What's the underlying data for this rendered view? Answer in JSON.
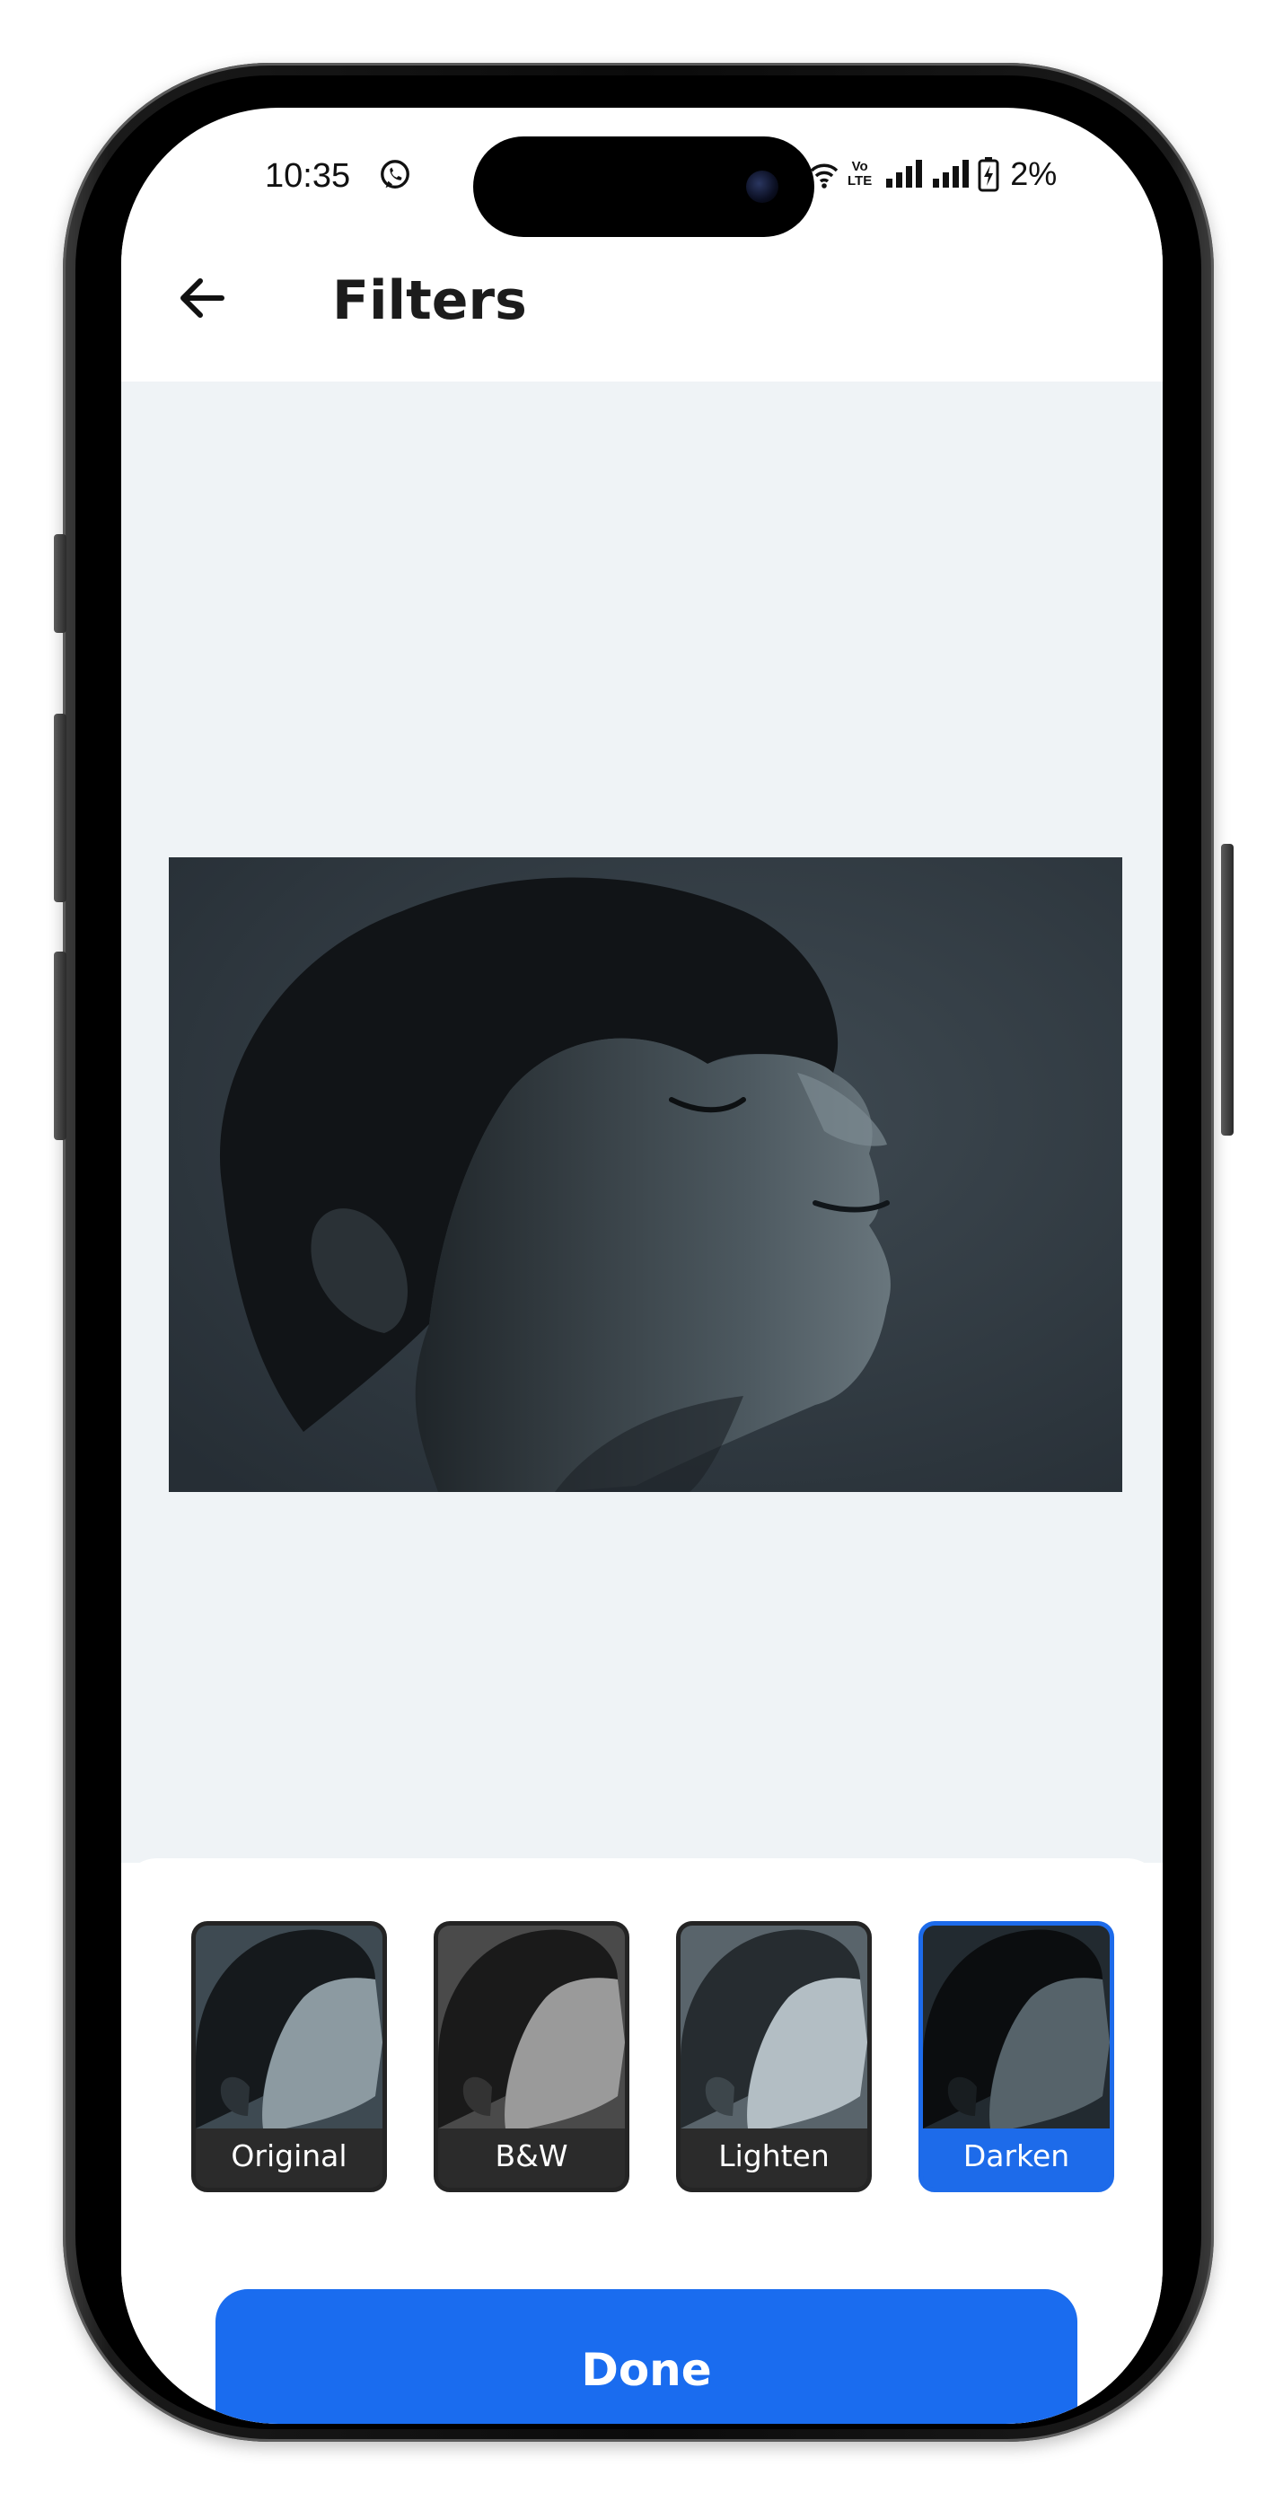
{
  "status_bar": {
    "time": "10:35",
    "battery": "2%",
    "network_label_top": "Vo",
    "network_label_bottom": "LTE"
  },
  "header": {
    "title": "Filters"
  },
  "preview": {
    "active_filter": "Darken"
  },
  "filters": [
    {
      "label": "Original",
      "selected": false
    },
    {
      "label": "B&W",
      "selected": false
    },
    {
      "label": "Lighten",
      "selected": false
    },
    {
      "label": "Darken",
      "selected": true
    }
  ],
  "actions": {
    "done_label": "Done"
  },
  "colors": {
    "accent": "#1a6cef",
    "preview_background": "#eff3f6",
    "thumb_border": "#242424",
    "title": "#1c1c1c"
  },
  "icons": {
    "back": "arrow-left-icon",
    "whatsapp": "whatsapp-icon",
    "wifi": "wifi-icon",
    "signal": "signal-icon",
    "battery": "battery-charging-icon"
  }
}
